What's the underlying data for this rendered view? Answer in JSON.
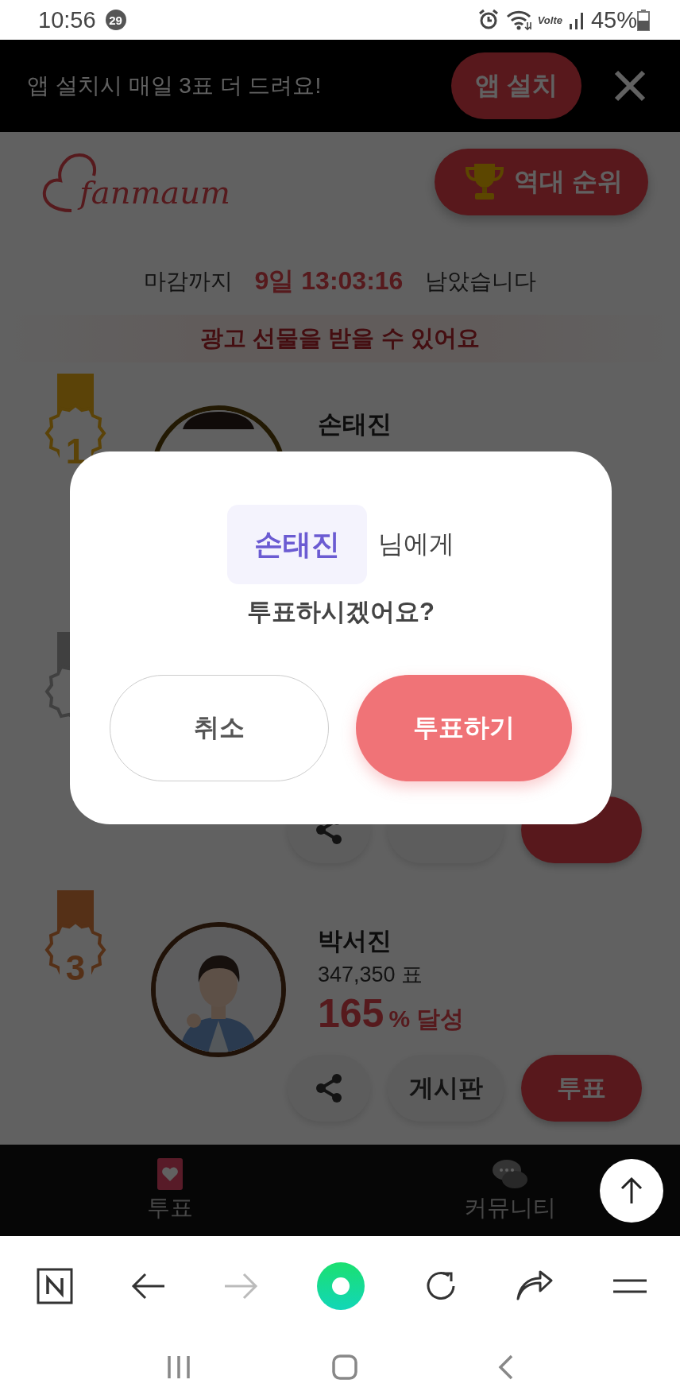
{
  "status_bar": {
    "time": "10:56",
    "notification_count": "29",
    "network_label": "Volte",
    "battery": "45%"
  },
  "app_banner": {
    "message": "앱 설치시 매일 3표 더 드려요!",
    "install_button": "앱 설치"
  },
  "header": {
    "logo": "fanmaum",
    "hall_of_fame_button": "역대 순위"
  },
  "countdown": {
    "prefix": "마감까지",
    "remaining": "9일 13:03:16",
    "suffix": "남았습니다"
  },
  "ad_notice": "광고 선물을 받을 수 있어요",
  "ranking": [
    {
      "kind": "name_only",
      "rank": "1",
      "color": "#5b4308",
      "name": "손태진"
    },
    {
      "kind": "buttons",
      "color": "#404040"
    },
    {
      "kind": "full",
      "rank": "3",
      "color": "#553017",
      "name": "박서진",
      "votes": "347,350 표",
      "percent": "165",
      "percent_unit": "% 달성",
      "board_button": "게시판",
      "vote_button": "투표"
    }
  ],
  "bottom_nav": [
    {
      "label": "투표",
      "selected": true
    },
    {
      "label": "커뮤니티",
      "selected": false
    }
  ],
  "dialog": {
    "name": "손태진",
    "suffix": "님에게",
    "question": "투표하시겠어요?",
    "cancel_button": "취소",
    "confirm_button": "투표하기"
  },
  "browser_toolbar": {
    "forward_disabled": true
  }
}
